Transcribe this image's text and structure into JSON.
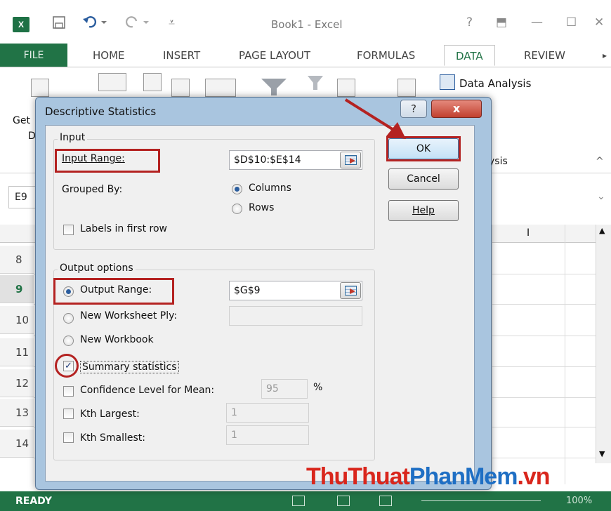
{
  "app": {
    "logo": "X",
    "title": "Book1 - Excel",
    "window_help": "?",
    "window_ribbon_toggle": "⬒",
    "window_minimize": "—",
    "window_maximize": "☐",
    "window_close": "✕",
    "brand_color": "#217346"
  },
  "ribbon": {
    "tabs": [
      "FILE",
      "HOME",
      "INSERT",
      "PAGE LAYOUT",
      "FORMULAS",
      "DATA",
      "REVIEW"
    ],
    "active_tab": "DATA",
    "data_analysis_label": "Data Analysis",
    "analysis_group_partial": "ysis",
    "get_data_partial_1": "Get",
    "get_data_partial_2": "D",
    "collapse_icon": "^"
  },
  "formula_bar": {
    "name_box": "E9"
  },
  "grid": {
    "column_visible": "I",
    "rows": [
      "8",
      "9",
      "10",
      "11",
      "12",
      "13",
      "14"
    ],
    "selected_row": "9"
  },
  "status_bar": {
    "ready": "READY",
    "zoom": "100%"
  },
  "watermark": {
    "part1": "ThuThuat",
    "part2": "PhanMem",
    "part3": ".vn"
  },
  "dialog": {
    "title": "Descriptive Statistics",
    "help_icon": "?",
    "close_icon": "x",
    "input_group": {
      "legend": "Input",
      "input_range_label": "Input Range:",
      "input_range_value": "$D$10:$E$14",
      "grouped_by_label": "Grouped By:",
      "columns_label": "Columns",
      "rows_label": "Rows",
      "grouped_by_selected": "Columns",
      "labels_first_row_label": "Labels in first row",
      "labels_first_row_checked": false
    },
    "output_group": {
      "legend": "Output options",
      "output_range_label": "Output Range:",
      "output_range_value": "$G$9",
      "new_worksheet_label": "New Worksheet Ply:",
      "new_worksheet_value": "",
      "new_workbook_label": "New Workbook",
      "output_selected": "Output Range",
      "summary_statistics_label": "Summary statistics",
      "summary_statistics_checked": true,
      "confidence_label": "Confidence Level for Mean:",
      "confidence_value": "95",
      "confidence_unit": "%",
      "confidence_checked": false,
      "kth_largest_label": "Kth Largest:",
      "kth_largest_value": "1",
      "kth_largest_checked": false,
      "kth_smallest_label": "Kth Smallest:",
      "kth_smallest_value": "1",
      "kth_smallest_checked": false
    },
    "buttons": {
      "ok": "OK",
      "cancel": "Cancel",
      "help": "Help"
    }
  },
  "annotation_color": "#b42221"
}
